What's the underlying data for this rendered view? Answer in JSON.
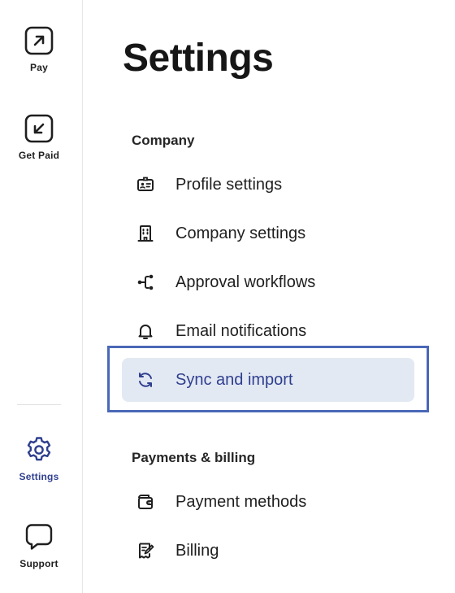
{
  "rail": {
    "items": [
      {
        "label": "Pay",
        "icon": "arrow-up-right-icon"
      },
      {
        "label": "Get Paid",
        "icon": "arrow-down-left-icon"
      },
      {
        "label": "Settings",
        "icon": "gear-icon"
      },
      {
        "label": "Support",
        "icon": "chat-bubble-icon"
      }
    ],
    "active_item": "Settings"
  },
  "page": {
    "title": "Settings"
  },
  "sections": [
    {
      "heading": "Company",
      "items": [
        {
          "label": "Profile settings",
          "icon": "id-card-icon"
        },
        {
          "label": "Company settings",
          "icon": "building-icon"
        },
        {
          "label": "Approval workflows",
          "icon": "workflow-branch-icon"
        },
        {
          "label": "Email notifications",
          "icon": "bell-icon"
        },
        {
          "label": "Sync and import",
          "icon": "sync-icon"
        }
      ]
    },
    {
      "heading": "Payments & billing",
      "items": [
        {
          "label": "Payment methods",
          "icon": "wallet-icon"
        },
        {
          "label": "Billing",
          "icon": "receipt-icon"
        }
      ]
    }
  ],
  "selected_item": "Sync and import",
  "colors": {
    "accent": "#2f3f8f",
    "selected_bg": "#e3e9f3",
    "highlight_border": "#4a68b8"
  }
}
